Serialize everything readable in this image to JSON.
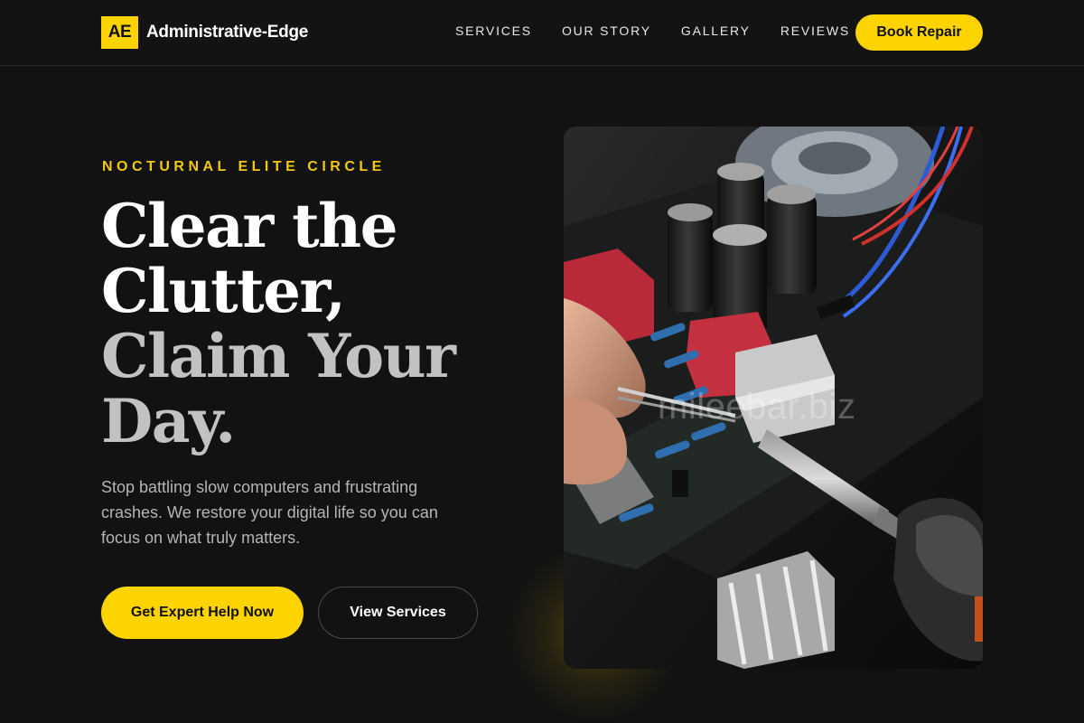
{
  "brand": {
    "logo_mark": "AE",
    "name": "Administrative-Edge",
    "accent_color": "#fdd400"
  },
  "nav": {
    "links": [
      "SERVICES",
      "OUR STORY",
      "GALLERY",
      "REVIEWS"
    ],
    "book_label": "Book Repair"
  },
  "hero": {
    "eyebrow": "NOCTURNAL ELITE CIRCLE",
    "headline_lines": [
      "Clear the",
      "Clutter,",
      "Claim Your",
      "Day."
    ],
    "subtext": "Stop battling slow computers and frustrating crashes. We restore your digital life so you can focus on what truly matters.",
    "primary_cta": "Get Expert Help Now",
    "secondary_cta": "View Services",
    "image_description_icon": "circuit-board-soldering-photo",
    "watermark": "mileebar.biz"
  }
}
